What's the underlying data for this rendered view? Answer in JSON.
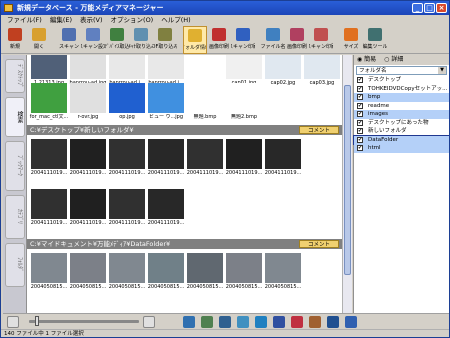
{
  "window": {
    "title": "新規データベース - 万能メディアマネージャー"
  },
  "menu": [
    "ファイル(F)",
    "編集(E)",
    "表示(V)",
    "オプション(O)",
    "ヘルプ(H)"
  ],
  "toolbar": [
    {
      "label": "新規",
      "color": "#c04020"
    },
    {
      "label": "開く",
      "color": "#d8a030"
    },
    {
      "label": "スキャン",
      "color": "#5070b0"
    },
    {
      "label": "スキャン設定",
      "color": "#6080c0"
    },
    {
      "label": "ﾃﾞﾊﾞｲｽ取込",
      "color": "#408040"
    },
    {
      "label": "ｽｷｬﾅ取り込み",
      "color": "#6090b0"
    },
    {
      "label": "DF取り込み",
      "color": "#808040"
    },
    {
      "label": "フォルダ情報",
      "color": "#e0b030"
    },
    {
      "label": "画像印刷",
      "color": "#c03030"
    },
    {
      "label": "スキャン印刷",
      "color": "#3060c0"
    },
    {
      "label": "ファイル名",
      "color": "#4080c0"
    },
    {
      "label": "画像印刷",
      "color": "#b04060"
    },
    {
      "label": "スキャン印刷",
      "color": "#c05050"
    },
    {
      "label": "サイズ",
      "color": "#e07020"
    },
    {
      "label": "編集ツール",
      "color": "#407070"
    }
  ],
  "left_tabs": [
    "ﾃﾞｽｸﾄｯﾌﾟ",
    "検索",
    "ﾌﾞｯｸﾏｰｸ",
    "ｶﾃｺﾞﾘ",
    "ﾌｫﾙﾀﾞ"
  ],
  "row1": [
    {
      "label": "1.21313.jpg",
      "color": "#506078"
    },
    {
      "label": "banrrou-ad.jpg",
      "color": "#e0e0e0"
    },
    {
      "label": "banrrou-ad.j...",
      "color": "#e8e8e8"
    },
    {
      "label": "banrrou-ad.j...",
      "color": "#e8e8e8"
    },
    {
      "label": "",
      "color": "#ffffff"
    },
    {
      "label": "cap01.jpg",
      "color": "#f0f0f0"
    },
    {
      "label": "cap02.jpg",
      "color": "#e0e8f0"
    },
    {
      "label": "cap03.jpg",
      "color": "#e0e8f0"
    }
  ],
  "row2": [
    {
      "label": "for_mac_ctl文...",
      "color": "#40a040"
    },
    {
      "label": "r-ovr.jpg",
      "color": "#e0e0e0"
    },
    {
      "label": "op.jpg",
      "color": "#2060d0"
    },
    {
      "label": "ビュー ウ...jpg",
      "color": "#4090e0"
    },
    {
      "label": "無題.bmp",
      "color": "#ffffff"
    },
    {
      "label": "無題2.bmp",
      "color": "#ffffff"
    }
  ],
  "folder1": {
    "path": "C:¥デスクトップ¥新しいフォルダ¥",
    "comment_btn": "コメント"
  },
  "folder1_items": [
    {
      "label": "2004111019...",
      "color": "#303030"
    },
    {
      "label": "2004111019...",
      "color": "#202020"
    },
    {
      "label": "2004111019...",
      "color": "#303030"
    },
    {
      "label": "2004111019...",
      "color": "#282828"
    },
    {
      "label": "2004111019...",
      "color": "#303030"
    },
    {
      "label": "2004111019...",
      "color": "#202020"
    },
    {
      "label": "2004111019...",
      "color": "#282828"
    },
    {
      "label": "2004111019...",
      "color": "#303030"
    },
    {
      "label": "2004111019...",
      "color": "#202020"
    },
    {
      "label": "2004111019...",
      "color": "#303030"
    },
    {
      "label": "2004111019...",
      "color": "#282828"
    }
  ],
  "folder2": {
    "path": "C:¥マイドキュメント¥万能ﾒﾃﾞｨｱ¥DataFolder¥",
    "comment_btn": "コメント"
  },
  "folder2_items": [
    {
      "label": "2004050815...",
      "color": "#808890"
    },
    {
      "label": "2004050815...",
      "color": "#7c8088"
    },
    {
      "label": "2004050815...",
      "color": "#808890"
    },
    {
      "label": "2004050815...",
      "color": "#708088"
    },
    {
      "label": "2004050815...",
      "color": "#606870"
    },
    {
      "label": "2004050815...",
      "color": "#7c8088"
    },
    {
      "label": "2004050815...",
      "color": "#808890"
    }
  ],
  "right_panel": {
    "radio1": "簡易",
    "radio2": "詳細",
    "select": "フォルダ名",
    "items": [
      {
        "label": "デスクトップ",
        "checked": "✔",
        "hl": false,
        "sel": false
      },
      {
        "label": "TOHKEIDVDCopyセットアッ...",
        "checked": "✔",
        "hl": false,
        "sel": false
      },
      {
        "label": "bmp",
        "checked": "✔",
        "hl": true,
        "sel": false
      },
      {
        "label": "readme",
        "checked": "✔",
        "hl": false,
        "sel": false
      },
      {
        "label": "images",
        "checked": "✔",
        "hl": true,
        "sel": false
      },
      {
        "label": "デスクトップにあった物",
        "checked": "✔",
        "hl": false,
        "sel": false
      },
      {
        "label": "新しいフォルダ",
        "checked": "✔",
        "hl": false,
        "sel": false
      },
      {
        "label": "DataFolder",
        "checked": "✔",
        "hl": false,
        "sel": true
      },
      {
        "label": "html",
        "checked": "✔",
        "hl": true,
        "sel": false
      }
    ]
  },
  "bottom_icons": [
    "#3070b0",
    "#508050",
    "#306090",
    "#4090c0",
    "#2080c0",
    "#3050a0",
    "#c03040",
    "#a06030",
    "#205090",
    "#3060b0"
  ],
  "status": "140 ファイル中 1 ファイル選択"
}
